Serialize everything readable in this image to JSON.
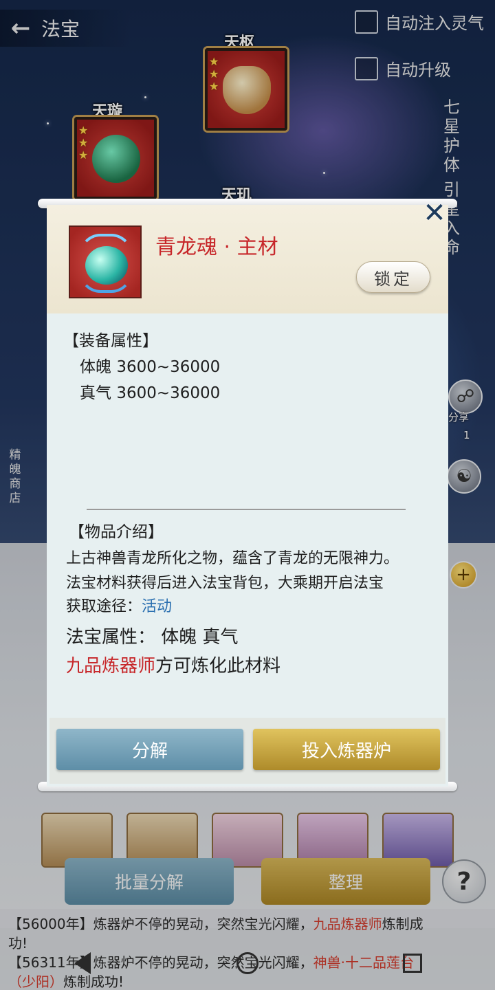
{
  "header": {
    "title": "法宝"
  },
  "options": {
    "auto_inject": "自动注入灵气",
    "auto_upgrade": "自动升级"
  },
  "side_text": {
    "seven_stars": "七星护体",
    "guide": "引星入命",
    "shop": "精魄商店",
    "share": "分享",
    "share_count": "1"
  },
  "slots": {
    "tianshu": "天枢",
    "tianxuan": "天璇",
    "tianji": "天玑"
  },
  "bottom": {
    "batch_decompose": "批量分解",
    "organize": "整理",
    "help": "?"
  },
  "chat": {
    "line1_prefix": "【56000年】",
    "line1_rest": "炼器炉不停的晃动，突然宝光闪耀，",
    "line1_red": "九品炼器师",
    "line1_end": "炼制成",
    "line1_wrap": "功!",
    "line2_prefix": "【56311年】炼器炉不停的晃动，突然宝光闪耀，",
    "line2_red": "神兽·十二品莲台",
    "line2_red2": "（少阳）",
    "line2_end": "炼制成功!"
  },
  "modal": {
    "item_name": "青龙魂 · 主材",
    "lock_label": "锁定",
    "close": "✕",
    "equip_attr_title": "【装备属性】",
    "attrs": [
      {
        "name": "体魄",
        "range": "3600~36000"
      },
      {
        "name": "真气",
        "range": "3600~36000"
      }
    ],
    "intro_title": "【物品介绍】",
    "intro_line1": "上古神兽青龙所化之物，蕴含了青龙的无限神力。",
    "intro_line2": "法宝材料获得后进入法宝背包，大乘期开启法宝",
    "source_label": "获取途径：",
    "source_value": "活动",
    "treasure_attr_label": "法宝属性：",
    "treasure_attr_value": "体魄 真气",
    "requirement_red": "九品炼器师",
    "requirement_rest": "方可炼化此材料",
    "decompose_label": "分解",
    "furnace_label": "投入炼器炉"
  },
  "colors": {
    "item_name": "#c7272a",
    "link": "#2a6fb0",
    "decompose_button": "#5e8ea7",
    "furnace_button": "#ae8b2a"
  }
}
